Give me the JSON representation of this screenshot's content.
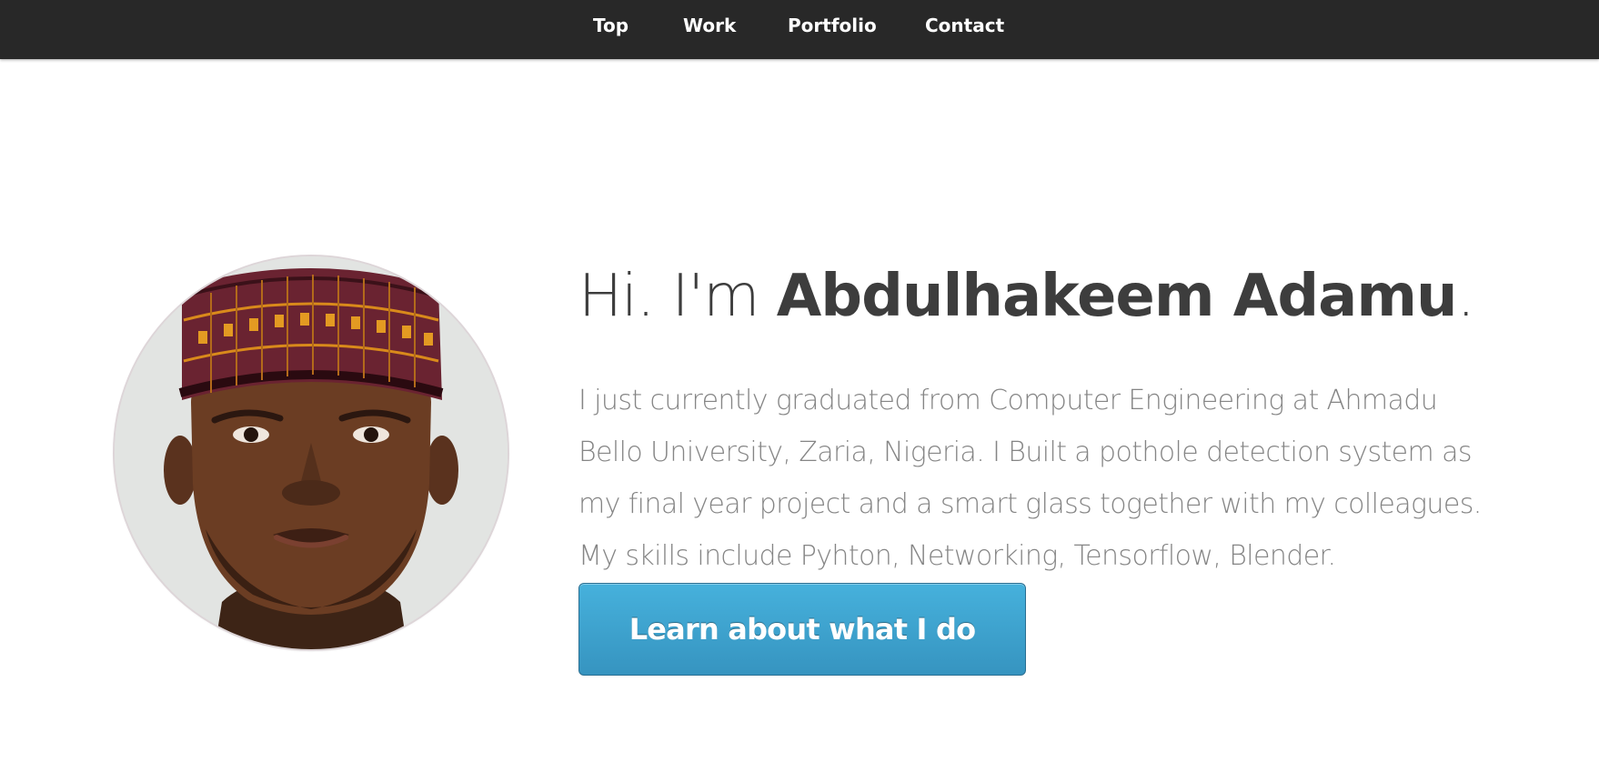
{
  "nav": {
    "items": [
      {
        "label": "Top"
      },
      {
        "label": "Work"
      },
      {
        "label": "Portfolio"
      },
      {
        "label": "Contact"
      }
    ]
  },
  "hero": {
    "greeting": "Hi. I'm ",
    "name": "Abdulhakeem Adamu",
    "punctuation": ".",
    "bio": "I just currently graduated from Computer Engineering at Ahmadu Bello University, Zaria, Nigeria. I Built a pothole detection system as my final year project and a smart glass together with my colleagues. My skills include Pyhton, Networking, Tensorflow, Blender.",
    "cta_label": "Learn about what I do"
  },
  "colors": {
    "nav_background": "#282828",
    "button_accent": "#3da3cf",
    "heading_text": "#3d3d3d",
    "body_text": "#858585"
  }
}
